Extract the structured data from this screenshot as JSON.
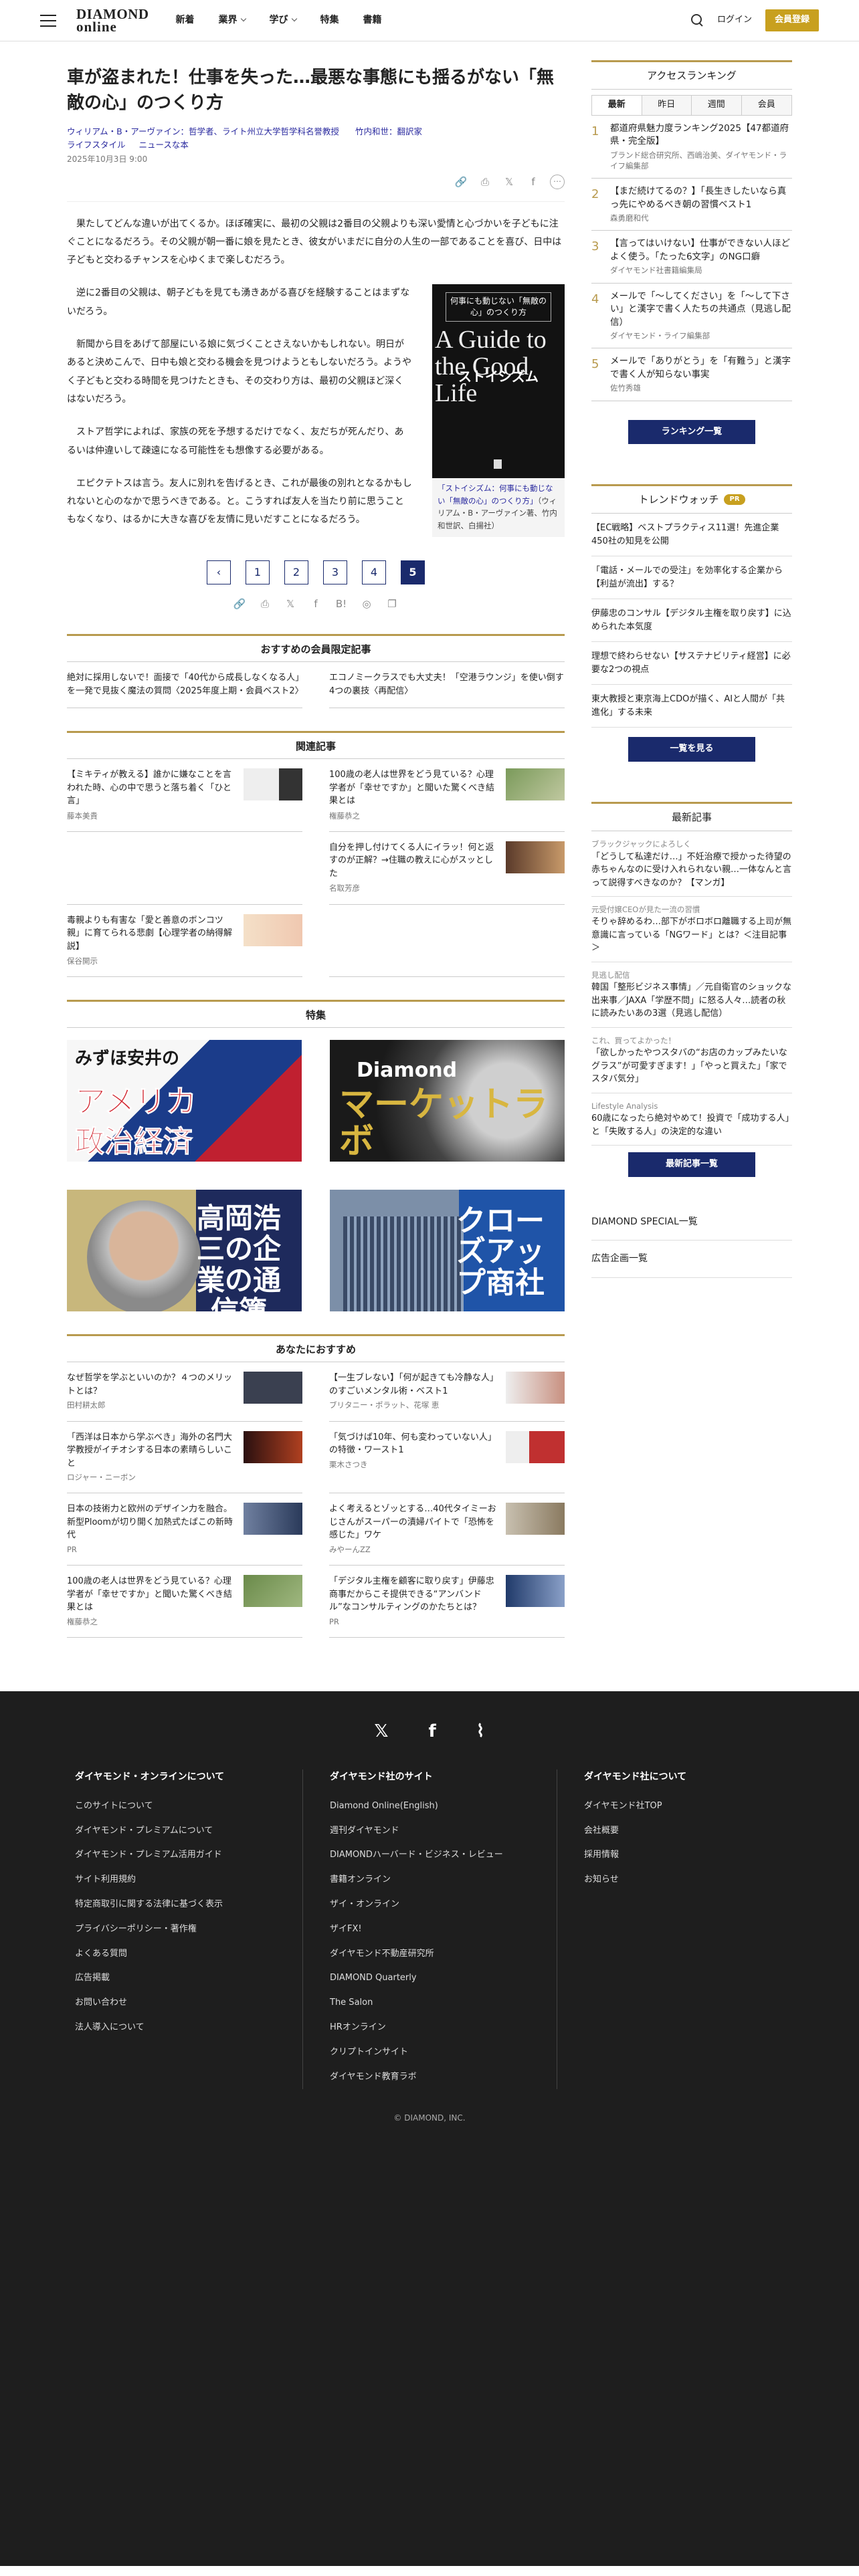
{
  "header": {
    "logo_top": "DIAMOND",
    "logo_bottom": "online",
    "nav": [
      "新着",
      "業界",
      "学び",
      "特集",
      "書籍"
    ],
    "login": "ログイン",
    "member": "会員登録"
  },
  "article": {
    "title": "車が盗まれた！仕事を失った…最悪な事態にも揺るがない「無敵の心」のつくり方",
    "author1": "ウィリアム・B・アーヴァイン：哲学者、ライト州立大学哲学科名誉教授",
    "author2": "竹内和世：翻訳家",
    "cat1": "ライフスタイル",
    "cat2": "ニュースな本",
    "date": "2025年10月3日 9:00",
    "p1": "果たしてどんな違いが出てくるか。ほぼ確実に、最初の父親は2番目の父親よりも深い愛情と心づかいを子どもに注ぐことになるだろう。その父親が朝一番に娘を見たとき、彼女がいまだに自分の人生の一部であることを喜び、日中は子どもと交わるチャンスを心ゆくまで楽しむだろう。",
    "p2": "逆に2番目の父親は、朝子どもを見ても湧きあがる喜びを経験することはまずないだろう。",
    "p3": "新聞から目をあげて部屋にいる娘に気づくことさえないかもしれない。明日があると決めこんで、日中も娘と交わる機会を見つけようともしないだろう。ようやく子どもと交わる時間を見つけたときも、その交わり方は、最初の父親ほど深くはないだろう。",
    "p4": "ストア哲学によれば、家族の死を予想するだけでなく、友だちが死んだり、あるいは仲違いして疎遠になる可能性をも想像する必要がある。",
    "p5": "エピクテトスは言う。友人に別れを告げるとき、これが最後の別れとなるかもしれないと心のなかで思うべきである。と。こうすれば友人を当たり前に思うこともなくなり、はるかに大きな喜びを友情に見いだすことになるだろう。",
    "book": {
      "tag": "何事にも動じない「無敵の心」のつくり方",
      "en": "A Guide to the Good Life",
      "ja": "ストイシズム",
      "caption_blue": "「ストイシズム：何事にも動じない「無敵の心」のつくり方」",
      "caption_rest": "（ウィリアム・B・アーヴァイン著、竹内和世訳、白揚社）"
    }
  },
  "pager": [
    "1",
    "2",
    "3",
    "4",
    "5"
  ],
  "premium": {
    "heading": "おすすめの会員限定記事",
    "items": [
      "絶対に採用しないで！面接で「40代から成長しなくなる人」を一発で見抜く魔法の質問〈2025年度上期・会員ベスト2〉",
      "エコノミークラスでも大丈夫！「空港ラウンジ」を使い倒す4つの裏技〈再配信〉"
    ]
  },
  "related": {
    "heading": "関連記事",
    "items": [
      {
        "t": "【ミキティが教える】誰かに嫌なことを言われた時、心の中で思うと落ち着く「ひと言」",
        "by": "藤本美貴"
      },
      {
        "t": "100歳の老人は世界をどう見ている？心理学者が「幸せですか」と聞いた驚くべき結果とは",
        "by": "権藤恭之"
      },
      {
        "t": "",
        "by": ""
      },
      {
        "t": "自分を押し付けてくる人にイラッ！何と返すのが正解？→住職の教えに心がスッとした",
        "by": "名取芳彦"
      },
      {
        "t": "毒親よりも有害な「愛と善意のボンコツ親」に育てられる悲劇【心理学者の納得解説】",
        "by": "保谷開示"
      },
      {
        "t": "",
        "by": ""
      }
    ]
  },
  "features": {
    "heading": "特集",
    "b1_l1": "みずほ安井の",
    "b1_l2": "アメリカ",
    "b1_l3": "政治経済",
    "b2_logo": "Diamond",
    "b2_t": "マーケットラボ",
    "b3_t": "高岡浩三の企業の通信簿",
    "b4_t": "クローズアップ商社"
  },
  "recommend": {
    "heading": "あなたにおすすめ",
    "items": [
      {
        "t": "なぜ哲学を学ぶといいのか？４つのメリットとは？",
        "by": "田村耕太郎"
      },
      {
        "t": "【一生ブレない】「何が起きても冷静な人」のすごいメンタル術・ベスト1",
        "by": "ブリタニー・ポラット、花塚 恵"
      },
      {
        "t": "「西洋は日本から学ぶべき」海外の名門大学教授がイチオシする日本の素晴らしいこと",
        "by": "ロジャー・ニーボン"
      },
      {
        "t": "「気づけば10年、何も変わっていない人」の特徴・ワースト1",
        "by": "栗木さつき"
      },
      {
        "t": "日本の技術力と欧州のデザイン力を融合。新型Ploomが切り開く加熱式たばこの新時代",
        "by": "PR"
      },
      {
        "t": "よく考えるとゾッとする…40代タイミーおじさんがスーパーの漬婦パイトで「恐怖を感じた」ワケ",
        "by": "みやーんZZ"
      },
      {
        "t": "100歳の老人は世界をどう見ている？心理学者が「幸せですか」と聞いた驚くべき結果とは",
        "by": "権藤恭之"
      },
      {
        "t": "「デジタル主権を顧客に取り戻す」伊藤忠商事だからこそ提供できる“アンバンドル”なコンサルティングのかたちとは？",
        "by": "PR"
      }
    ]
  },
  "sidebar": {
    "ranking_heading": "アクセスランキング",
    "tabs": [
      "最新",
      "昨日",
      "週間",
      "会員"
    ],
    "ranking": [
      {
        "n": "1",
        "t": "都道府県魅力度ランキング2025【47都道府県・完全版】",
        "by": "ブランド総合研究所、西嶋治美、ダイヤモンド・ライフ編集部"
      },
      {
        "n": "2",
        "t": "【まだ続けてるの？】「長生きしたいなら真っ先にやめるべき朝の習慣ベスト1",
        "by": "森勇磨和代"
      },
      {
        "n": "3",
        "t": "【言ってはいけない】仕事ができない人ほどよく使う。「たった6文字」のNG口癖",
        "by": "ダイヤモンド社書籍編集局"
      },
      {
        "n": "4",
        "t": "メールで「～してください」を「～して下さい」と漢字で書く人たちの共通点（見逃し配信）",
        "by": "ダイヤモンド・ライフ編集部"
      },
      {
        "n": "5",
        "t": "メールで「ありがとう」を「有難う」と漢字で書く人が知らない事実",
        "by": "佐竹秀雄"
      }
    ],
    "ranking_btn": "ランキング一覧",
    "trend_heading": "トレンドウォッチ",
    "pr": "PR",
    "trend": [
      "【EC戦略】ベストプラクティス11選！先進企業450社の知見を公開",
      "「電話・メールでの受注」を効率化する企業から【利益が流出】する？",
      "伊藤忠のコンサル【デジタル主権を取り戻す】に込められた本気度",
      "理想で終わらせない【サステナビリティ経営】に必要な2つの視点",
      "東大教授と東京海上CDOが描く、AIと人間が「共進化」する未来"
    ],
    "trend_btn": "一覧を見る",
    "news_heading": "最新記事",
    "news": [
      {
        "c": "ブラックジャックによろしく",
        "t": "「どうして私達だけ…」不妊治療で授かった待望の赤ちゃんなのに受け入れられない親…一体なんと言って説得すべきなのか？【マンガ】"
      },
      {
        "c": "元受付嬢CEOが見た一流の習慣",
        "t": "そりゃ辞めるわ…部下がボロボロ離職する上司が無意識に言っている「NGワード」とは？＜注目記事＞"
      },
      {
        "c": "見逃し配信",
        "t": "韓国「整形ビジネス事情」／元自衛官のショックな出来事／JAXA「学歴不問」に怒る人々…読者の秋に読みたいあの3選（見逃し配信）"
      },
      {
        "c": "これ、買ってよかった！",
        "t": "「欲しかったやつスタバの“お店のカップみたいなグラス”が可愛すぎます！」「やっと買えた」「家でスタバ気分」"
      },
      {
        "c": "Lifestyle Analysis",
        "t": "60歳になったら絶対やめて！投資で「成功する人」と「失敗する人」の決定的な違い"
      }
    ],
    "news_btn": "最新記事一覧",
    "link1": "DIAMOND SPECIAL一覧",
    "link2": "広告企画一覧"
  },
  "footer": {
    "col1_h": "ダイヤモンド・オンラインについて",
    "col1": [
      "このサイトについて",
      "ダイヤモンド・プレミアムについて",
      "ダイヤモンド・プレミアム活用ガイド",
      "サイト利用規約",
      "特定商取引に関する法律に基づく表示",
      "プライバシーポリシー・著作権",
      "よくある質問",
      "広告掲載",
      "お問い合わせ",
      "法人導入について"
    ],
    "col2_h": "ダイヤモンド社のサイト",
    "col2": [
      "Diamond Online(English)",
      "週刊ダイヤモンド",
      "DIAMONDハーバード・ビジネス・レビュー",
      "書籍オンライン",
      "ザイ・オンライン",
      "ザイFX!",
      "ダイヤモンド不動産研究所",
      "DIAMOND Quarterly",
      "The Salon",
      "HRオンライン",
      "クリプトインサイト",
      "ダイヤモンド教育ラボ"
    ],
    "col3_h": "ダイヤモンド社について",
    "col3": [
      "ダイヤモンド社TOP",
      "会社概要",
      "採用情報",
      "お知らせ"
    ],
    "copy": "© DIAMOND, INC."
  }
}
